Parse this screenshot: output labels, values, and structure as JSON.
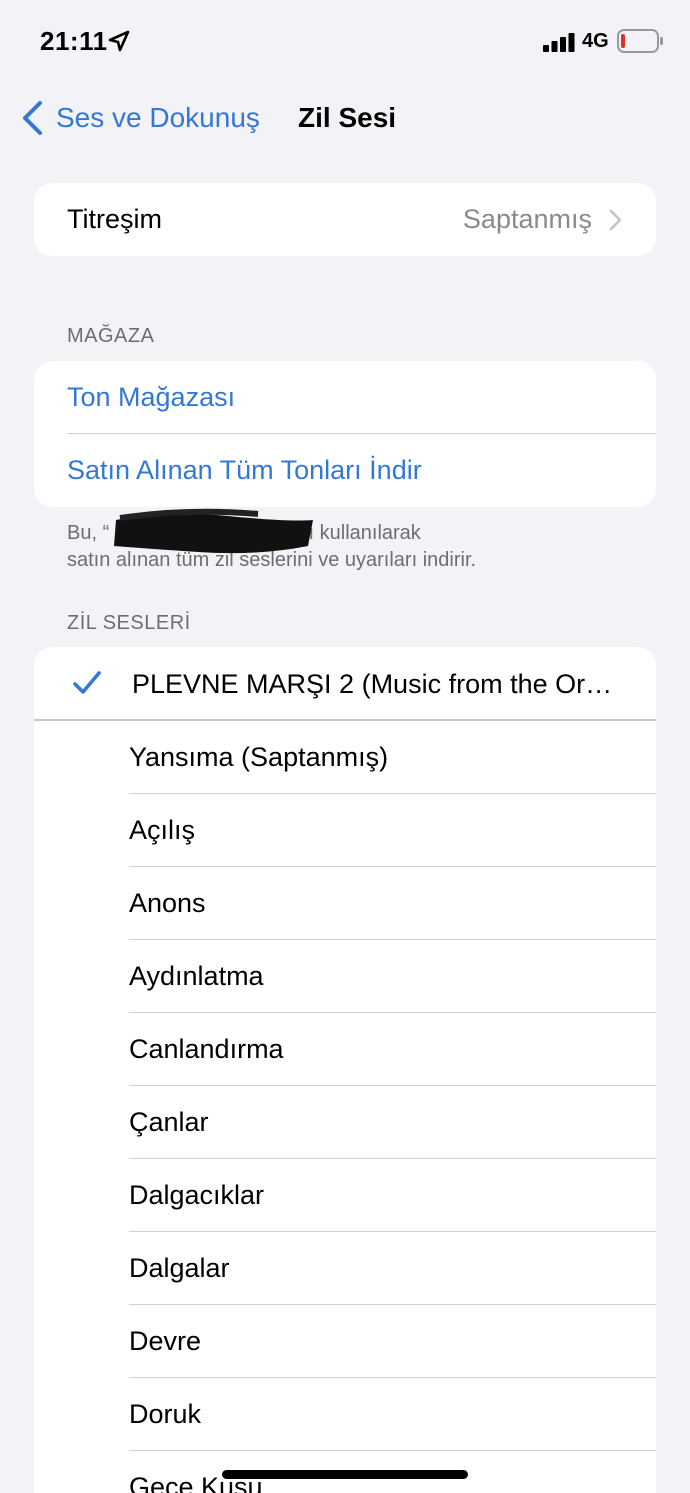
{
  "status_bar": {
    "time": "21:11",
    "network": "4G",
    "battery_color": "#e0302a"
  },
  "nav": {
    "back_label": "Ses ve Dokunuş",
    "title": "Zil Sesi"
  },
  "vibration": {
    "label": "Titreşim",
    "value": "Saptanmış"
  },
  "store": {
    "header": "MAĞAZA",
    "items": [
      {
        "label": "Ton Mağazası"
      },
      {
        "label": "Satın Alınan Tüm Tonları İndir"
      }
    ],
    "footer_line1": "Bu, “ 1@icloud.com” hesabı kullanılarak",
    "footer_line2": "satın alınan tüm zil seslerini ve uyarıları indirir."
  },
  "ringtones": {
    "header": "ZİL SESLERİ",
    "selected": "PLEVNE MARŞI 2 (Music from the Or…",
    "items": [
      {
        "label": "Yansıma (Saptanmış)"
      },
      {
        "label": "Açılış"
      },
      {
        "label": "Anons"
      },
      {
        "label": "Aydınlatma"
      },
      {
        "label": "Canlandırma"
      },
      {
        "label": "Çanlar"
      },
      {
        "label": "Dalgacıklar"
      },
      {
        "label": "Dalgalar"
      },
      {
        "label": "Devre"
      },
      {
        "label": "Doruk"
      },
      {
        "label": "Gece Kuşu"
      }
    ]
  },
  "colors": {
    "accent": "#3478d6",
    "background": "#f2f2f7",
    "secondary_text": "#6d6d72"
  }
}
